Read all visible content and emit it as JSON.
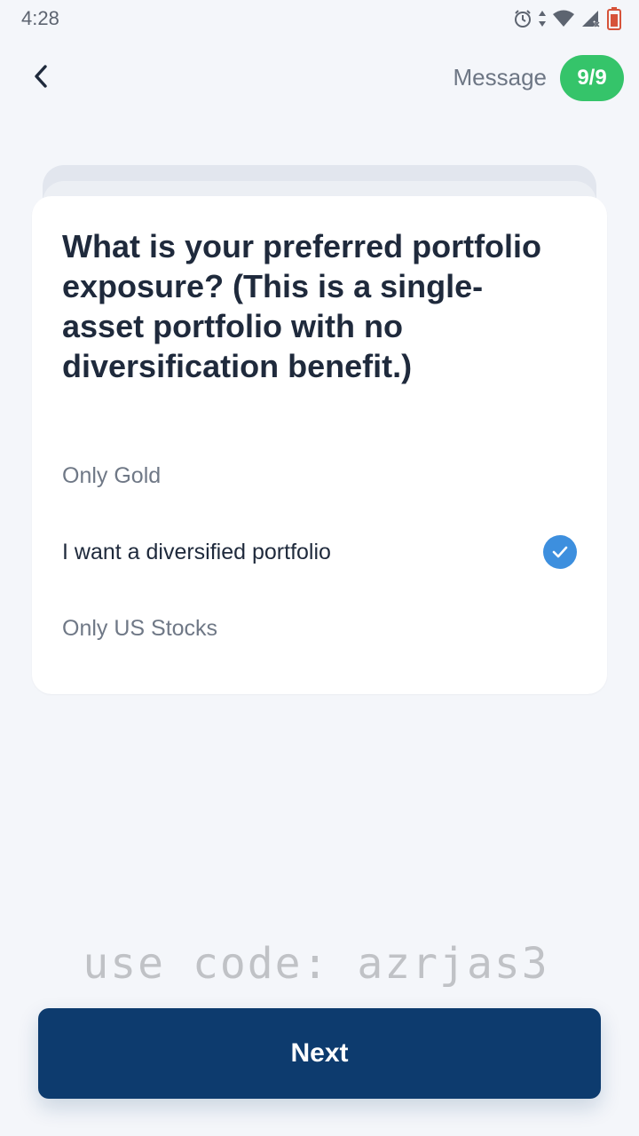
{
  "status_bar": {
    "time": "4:28",
    "icons": [
      "alarm-icon",
      "data-arrows-icon",
      "wifi-icon",
      "signal-icon",
      "battery-icon"
    ]
  },
  "header": {
    "back_icon": "chevron-left-icon",
    "message_label": "Message",
    "progress": "9/9",
    "progress_color": "#35c46a"
  },
  "question": {
    "title": "What is your preferred portfolio exposure? (This is a single-asset portfolio with no diversification benefit.)",
    "options": [
      {
        "label": "Only Gold",
        "selected": false
      },
      {
        "label": "I want a diversified portfolio",
        "selected": true
      },
      {
        "label": "Only US Stocks",
        "selected": false
      }
    ],
    "check_color": "#3d8fde"
  },
  "watermark": "use code: azrjas3",
  "footer": {
    "next_label": "Next",
    "button_color": "#0d3b6e"
  }
}
